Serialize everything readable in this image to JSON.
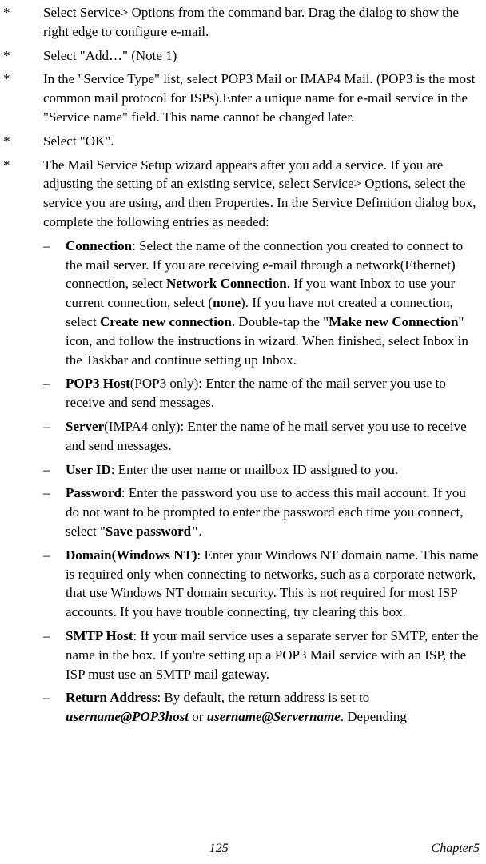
{
  "star_marker": "*",
  "dash_marker": "–",
  "items": {
    "i1": "Select Service> Options from the command bar. Drag the dialog to show the right edge to configure e-mail.",
    "i2": "Select \"Add…\" (Note 1)",
    "i3": "In the \"Service Type\" list, select POP3 Mail or IMAP4 Mail. (POP3 is the most common mail protocol for ISPs).Enter a unique name for e-mail service in the \"Service name\" field. This name cannot be changed later.",
    "i4": "Select \"OK\".",
    "i5": "The Mail Service Setup wizard appears after you add a service. If you are adjusting the setting of an existing service, select Service> Options, select the service you are using, and then Properties. In the Service Definition dialog box, complete the following entries as needed:"
  },
  "sub": {
    "conn": {
      "label": "Connection",
      "t1": ": Select the name of the connection you created to connect to the mail server. If you are receiving e-mail through a network(Ethernet) connection, select ",
      "b1": "Network Connection",
      "t2": ". If you want Inbox to use your current connection, select (",
      "b2": "none",
      "t3": "). If you have not created a connection, select ",
      "b3": "Create new connection",
      "t4": ". Double-tap the \"",
      "b4": "Make new Connection",
      "t5": "\" icon, and follow the instructions in wizard. When finished, select Inbox in the Taskbar and continue setting up Inbox."
    },
    "pop3host": {
      "label": "POP3 Host",
      "rest": "(POP3 only): Enter the name of the mail server you use to receive and send messages."
    },
    "server": {
      "label": "Server",
      "rest": "(IMPA4 only): Enter the name of he mail server you use to receive and send messages."
    },
    "userid": {
      "label": "User ID",
      "rest": ": Enter the user name or mailbox ID assigned to you."
    },
    "password": {
      "label": "Password",
      "t1": ": Enter the password you use to access this mail account. If you do not want to be prompted to enter the password each time you connect, select \"",
      "b1": "Save password\"",
      "t2": "."
    },
    "domain": {
      "label": "Domain(Windows NT)",
      "rest": ": Enter your Windows NT domain name. This name is required only when connecting to networks, such as a corporate network, that use Windows NT domain security. This is not required for most ISP accounts. If you have trouble connecting, try clearing this box."
    },
    "smtp": {
      "label": "SMTP Host",
      "rest": ": If your mail service uses a separate server for SMTP, enter the name in the box. If you're setting up a POP3 Mail service with an ISP, the ISP must use an SMTP mail gateway."
    },
    "return": {
      "label": "Return Address",
      "t1": ": By default, the return address is set to ",
      "bi1": "username@POP3host",
      "t2": " or ",
      "bi2": "username@Servername",
      "t3": ". Depending"
    }
  },
  "footer": {
    "page": "125",
    "chapter": "Chapter5"
  }
}
